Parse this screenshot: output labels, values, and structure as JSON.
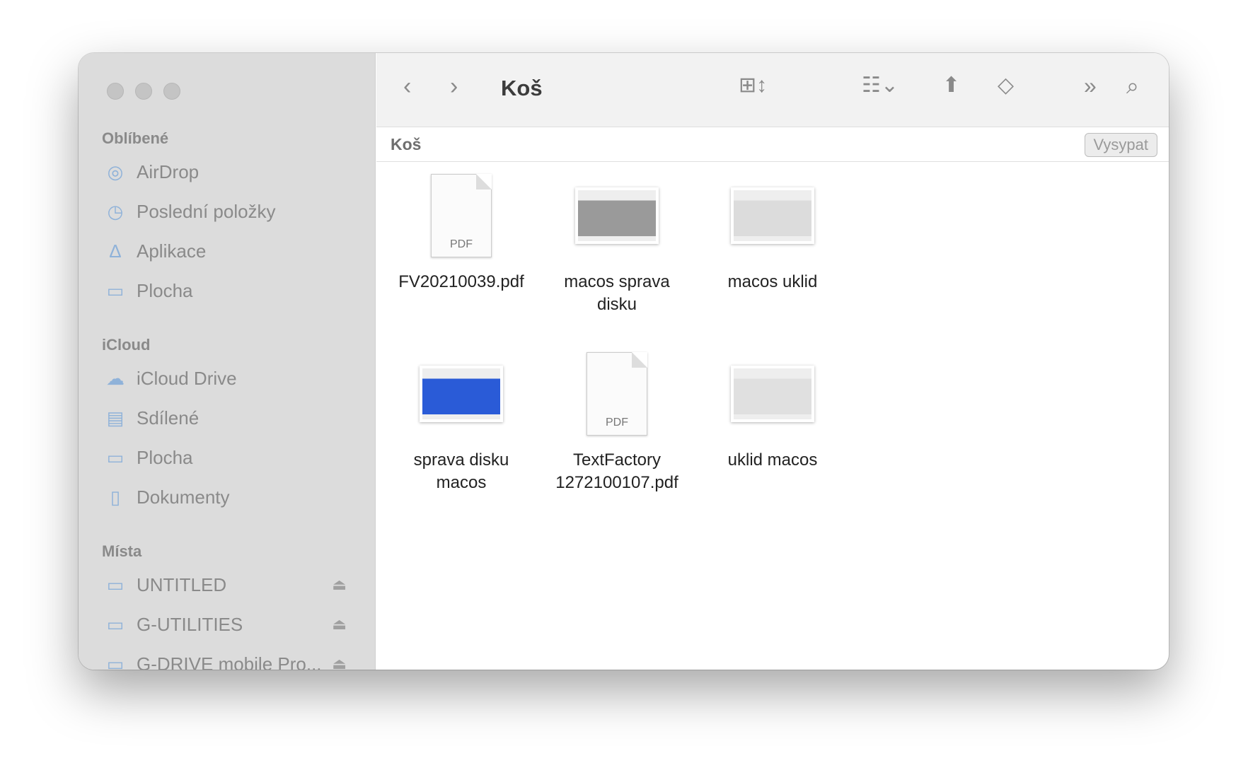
{
  "window": {
    "title": "Koš"
  },
  "sidebar": {
    "sections": [
      {
        "title": "Oblíbené",
        "items": [
          {
            "label": "AirDrop",
            "icon": "airdrop-icon"
          },
          {
            "label": "Poslední položky",
            "icon": "clock-icon"
          },
          {
            "label": "Aplikace",
            "icon": "apps-icon"
          },
          {
            "label": "Plocha",
            "icon": "desktop-icon"
          }
        ]
      },
      {
        "title": "iCloud",
        "items": [
          {
            "label": "iCloud Drive",
            "icon": "cloud-icon"
          },
          {
            "label": "Sdílené",
            "icon": "shared-folder-icon"
          },
          {
            "label": "Plocha",
            "icon": "desktop-icon"
          },
          {
            "label": "Dokumenty",
            "icon": "document-icon"
          }
        ]
      },
      {
        "title": "Místa",
        "items": [
          {
            "label": "UNTITLED",
            "icon": "drive-icon"
          },
          {
            "label": "G-UTILITIES",
            "icon": "drive-icon"
          },
          {
            "label": "G-DRIVE mobile Pro...",
            "icon": "drive-icon"
          }
        ]
      }
    ]
  },
  "toolbar": {
    "title": "Koš"
  },
  "pathbar": {
    "location": "Koš",
    "empty_button": "Vysypat"
  },
  "files": [
    {
      "name": "FV20210039.pdf",
      "type": "pdf",
      "badge": "PDF"
    },
    {
      "name": "macos sprava disku",
      "type": "image",
      "accent": "#9a9a9a"
    },
    {
      "name": "macos uklid",
      "type": "image",
      "accent": "#dcdcdc"
    },
    {
      "name": "sprava disku macos",
      "type": "image",
      "accent": "#2a5bd7"
    },
    {
      "name": "TextFactory 1272100107.pdf",
      "type": "pdf",
      "badge": "PDF"
    },
    {
      "name": "uklid macos",
      "type": "image",
      "accent": "#e0e0e0"
    }
  ]
}
